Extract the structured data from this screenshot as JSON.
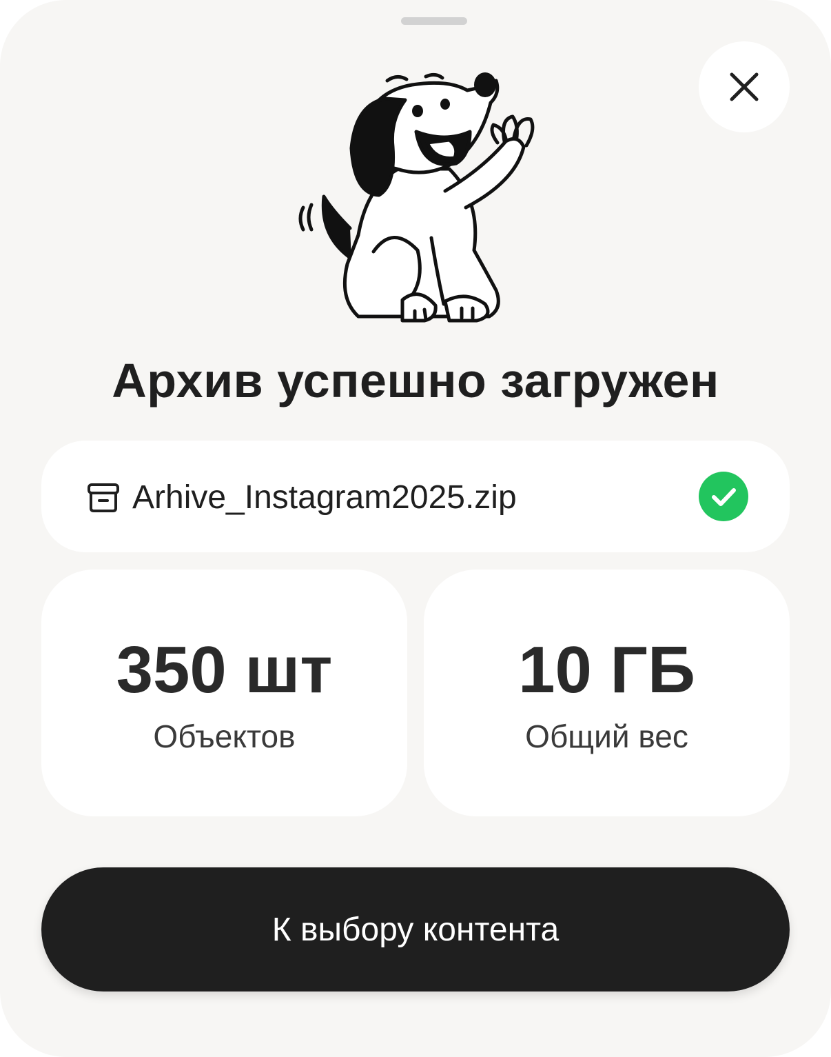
{
  "sheet": {
    "title": "Архив успешно загружен",
    "close_icon": "close-icon",
    "illustration": "waving-dog-illustration"
  },
  "file": {
    "name": "Arhive_Instagram2025.zip",
    "icon": "archive-icon",
    "status_icon": "check-circle-icon",
    "status_color": "#22c55e"
  },
  "stats": [
    {
      "value": "350 шт",
      "label": "Объектов"
    },
    {
      "value": "10 ГБ",
      "label": "Общий вес"
    }
  ],
  "primary_button": {
    "label": "К выбору контента",
    "color": "#1f1f1f"
  },
  "colors": {
    "background": "#f7f6f4",
    "card": "#ffffff",
    "text": "#1f1f1f"
  }
}
